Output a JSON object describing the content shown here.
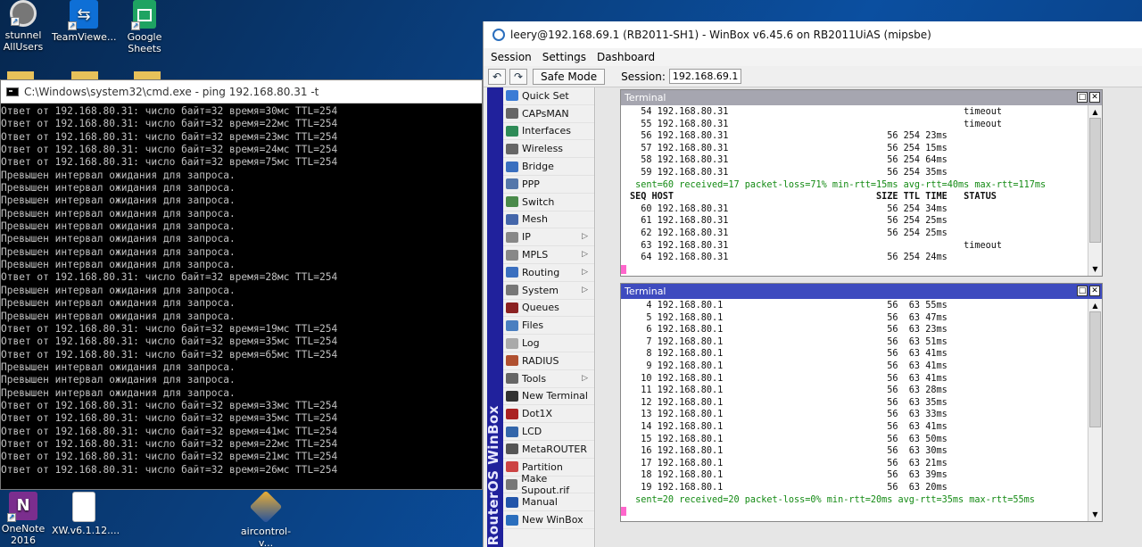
{
  "desktop": {
    "icons": [
      {
        "label": "stunnel\nAllUsers"
      },
      {
        "label": "TeamViewe..."
      },
      {
        "label": "Google\nSheets"
      },
      {
        "label": "OneNote\n2016"
      },
      {
        "label": "XW.v6.1.12...."
      },
      {
        "label": "aircontrol-v..."
      }
    ]
  },
  "cmd": {
    "title": "C:\\Windows\\system32\\cmd.exe - ping  192.168.80.31 -t",
    "lines": [
      "Ответ от 192.168.80.31: число байт=32 время=30мс TTL=254",
      "Ответ от 192.168.80.31: число байт=32 время=22мс TTL=254",
      "Ответ от 192.168.80.31: число байт=32 время=23мс TTL=254",
      "Ответ от 192.168.80.31: число байт=32 время=24мс TTL=254",
      "Ответ от 192.168.80.31: число байт=32 время=75мс TTL=254",
      "Превышен интервал ожидания для запроса.",
      "Превышен интервал ожидания для запроса.",
      "Превышен интервал ожидания для запроса.",
      "Превышен интервал ожидания для запроса.",
      "Превышен интервал ожидания для запроса.",
      "Превышен интервал ожидания для запроса.",
      "Превышен интервал ожидания для запроса.",
      "Превышен интервал ожидания для запроса.",
      "Ответ от 192.168.80.31: число байт=32 время=28мс TTL=254",
      "Превышен интервал ожидания для запроса.",
      "Превышен интервал ожидания для запроса.",
      "Превышен интервал ожидания для запроса.",
      "Ответ от 192.168.80.31: число байт=32 время=19мс TTL=254",
      "Ответ от 192.168.80.31: число байт=32 время=35мс TTL=254",
      "Ответ от 192.168.80.31: число байт=32 время=65мс TTL=254",
      "Превышен интервал ожидания для запроса.",
      "Превышен интервал ожидания для запроса.",
      "Превышен интервал ожидания для запроса.",
      "Ответ от 192.168.80.31: число байт=32 время=33мс TTL=254",
      "Ответ от 192.168.80.31: число байт=32 время=35мс TTL=254",
      "Ответ от 192.168.80.31: число байт=32 время=41мс TTL=254",
      "Ответ от 192.168.80.31: число байт=32 время=22мс TTL=254",
      "Ответ от 192.168.80.31: число байт=32 время=21мс TTL=254",
      "Ответ от 192.168.80.31: число байт=32 время=26мс TTL=254"
    ]
  },
  "winbox": {
    "title": "leery@192.168.69.1 (RB2011-SH1) - WinBox v6.45.6 on RB2011UiAS (mipsbe)",
    "menu": [
      "Session",
      "Settings",
      "Dashboard"
    ],
    "toolbar": {
      "undo": "↶",
      "redo": "↷",
      "safe_mode": "Safe Mode",
      "session_label": "Session:",
      "session_value": "192.168.69.1"
    },
    "side_label": "RouterOS WinBox",
    "nav": [
      {
        "label": "Quick Set",
        "icon": "quick-set-icon",
        "color": "#3a7bd5",
        "arrow": ""
      },
      {
        "label": "CAPsMAN",
        "icon": "capsman-icon",
        "color": "#666666",
        "arrow": ""
      },
      {
        "label": "Interfaces",
        "icon": "interfaces-icon",
        "color": "#2e8b57",
        "arrow": ""
      },
      {
        "label": "Wireless",
        "icon": "wireless-icon",
        "color": "#666666",
        "arrow": ""
      },
      {
        "label": "Bridge",
        "icon": "bridge-icon",
        "color": "#3a6fbf",
        "arrow": ""
      },
      {
        "label": "PPP",
        "icon": "ppp-icon",
        "color": "#5577aa",
        "arrow": ""
      },
      {
        "label": "Switch",
        "icon": "switch-icon",
        "color": "#4a8a4a",
        "arrow": ""
      },
      {
        "label": "Mesh",
        "icon": "mesh-icon",
        "color": "#4466aa",
        "arrow": ""
      },
      {
        "label": "IP",
        "icon": "ip-icon",
        "color": "#888888",
        "arrow": "▷"
      },
      {
        "label": "MPLS",
        "icon": "mpls-icon",
        "color": "#888888",
        "arrow": "▷"
      },
      {
        "label": "Routing",
        "icon": "routing-icon",
        "color": "#3a6fbf",
        "arrow": "▷"
      },
      {
        "label": "System",
        "icon": "system-icon",
        "color": "#777777",
        "arrow": "▷"
      },
      {
        "label": "Queues",
        "icon": "queues-icon",
        "color": "#8b2222",
        "arrow": ""
      },
      {
        "label": "Files",
        "icon": "files-icon",
        "color": "#4a7fc0",
        "arrow": ""
      },
      {
        "label": "Log",
        "icon": "log-icon",
        "color": "#aaaaaa",
        "arrow": ""
      },
      {
        "label": "RADIUS",
        "icon": "radius-icon",
        "color": "#b05030",
        "arrow": ""
      },
      {
        "label": "Tools",
        "icon": "tools-icon",
        "color": "#666666",
        "arrow": "▷"
      },
      {
        "label": "New Terminal",
        "icon": "terminal-icon",
        "color": "#333333",
        "arrow": ""
      },
      {
        "label": "Dot1X",
        "icon": "dot1x-icon",
        "color": "#aa2222",
        "arrow": ""
      },
      {
        "label": "LCD",
        "icon": "lcd-icon",
        "color": "#3366aa",
        "arrow": ""
      },
      {
        "label": "MetaROUTER",
        "icon": "metarouter-icon",
        "color": "#555555",
        "arrow": ""
      },
      {
        "label": "Partition",
        "icon": "partition-icon",
        "color": "#cc4444",
        "arrow": ""
      },
      {
        "label": "Make Supout.rif",
        "icon": "supout-icon",
        "color": "#777777",
        "arrow": ""
      },
      {
        "label": "Manual",
        "icon": "manual-icon",
        "color": "#2255aa",
        "arrow": ""
      },
      {
        "label": "New WinBox",
        "icon": "new-winbox-icon",
        "color": "#2a6ebd",
        "arrow": ""
      }
    ],
    "terminal1": {
      "title": "Terminal",
      "rows": [
        {
          "seq": "54",
          "host": "192.168.80.31",
          "size": "",
          "ttl": "",
          "time": "",
          "status": "timeout"
        },
        {
          "seq": "55",
          "host": "192.168.80.31",
          "size": "",
          "ttl": "",
          "time": "",
          "status": "timeout"
        },
        {
          "seq": "56",
          "host": "192.168.80.31",
          "size": "56",
          "ttl": "254",
          "time": "23ms",
          "status": ""
        },
        {
          "seq": "57",
          "host": "192.168.80.31",
          "size": "56",
          "ttl": "254",
          "time": "15ms",
          "status": ""
        },
        {
          "seq": "58",
          "host": "192.168.80.31",
          "size": "56",
          "ttl": "254",
          "time": "64ms",
          "status": ""
        },
        {
          "seq": "59",
          "host": "192.168.80.31",
          "size": "56",
          "ttl": "254",
          "time": "35ms",
          "status": ""
        }
      ],
      "summary": "sent=60 received=17 packet-loss=71% min-rtt=15ms avg-rtt=40ms max-rtt=117ms",
      "header": "SEQ HOST                                     SIZE TTL TIME   STATUS",
      "rows2": [
        {
          "seq": "60",
          "host": "192.168.80.31",
          "size": "56",
          "ttl": "254",
          "time": "34ms",
          "status": ""
        },
        {
          "seq": "61",
          "host": "192.168.80.31",
          "size": "56",
          "ttl": "254",
          "time": "25ms",
          "status": ""
        },
        {
          "seq": "62",
          "host": "192.168.80.31",
          "size": "56",
          "ttl": "254",
          "time": "25ms",
          "status": ""
        },
        {
          "seq": "63",
          "host": "192.168.80.31",
          "size": "",
          "ttl": "",
          "time": "",
          "status": "timeout"
        },
        {
          "seq": "64",
          "host": "192.168.80.31",
          "size": "56",
          "ttl": "254",
          "time": "24ms",
          "status": ""
        }
      ]
    },
    "terminal2": {
      "title": "Terminal",
      "rows": [
        {
          "seq": "4",
          "host": "192.168.80.1",
          "size": "56",
          "ttl": "63",
          "time": "55ms"
        },
        {
          "seq": "5",
          "host": "192.168.80.1",
          "size": "56",
          "ttl": "63",
          "time": "47ms"
        },
        {
          "seq": "6",
          "host": "192.168.80.1",
          "size": "56",
          "ttl": "63",
          "time": "23ms"
        },
        {
          "seq": "7",
          "host": "192.168.80.1",
          "size": "56",
          "ttl": "63",
          "time": "51ms"
        },
        {
          "seq": "8",
          "host": "192.168.80.1",
          "size": "56",
          "ttl": "63",
          "time": "41ms"
        },
        {
          "seq": "9",
          "host": "192.168.80.1",
          "size": "56",
          "ttl": "63",
          "time": "41ms"
        },
        {
          "seq": "10",
          "host": "192.168.80.1",
          "size": "56",
          "ttl": "63",
          "time": "41ms"
        },
        {
          "seq": "11",
          "host": "192.168.80.1",
          "size": "56",
          "ttl": "63",
          "time": "28ms"
        },
        {
          "seq": "12",
          "host": "192.168.80.1",
          "size": "56",
          "ttl": "63",
          "time": "35ms"
        },
        {
          "seq": "13",
          "host": "192.168.80.1",
          "size": "56",
          "ttl": "63",
          "time": "33ms"
        },
        {
          "seq": "14",
          "host": "192.168.80.1",
          "size": "56",
          "ttl": "63",
          "time": "41ms"
        },
        {
          "seq": "15",
          "host": "192.168.80.1",
          "size": "56",
          "ttl": "63",
          "time": "50ms"
        },
        {
          "seq": "16",
          "host": "192.168.80.1",
          "size": "56",
          "ttl": "63",
          "time": "30ms"
        },
        {
          "seq": "17",
          "host": "192.168.80.1",
          "size": "56",
          "ttl": "63",
          "time": "21ms"
        },
        {
          "seq": "18",
          "host": "192.168.80.1",
          "size": "56",
          "ttl": "63",
          "time": "39ms"
        },
        {
          "seq": "19",
          "host": "192.168.80.1",
          "size": "56",
          "ttl": "63",
          "time": "20ms"
        }
      ],
      "summary": "sent=20 received=20 packet-loss=0% min-rtt=20ms avg-rtt=35ms max-rtt=55ms"
    }
  }
}
